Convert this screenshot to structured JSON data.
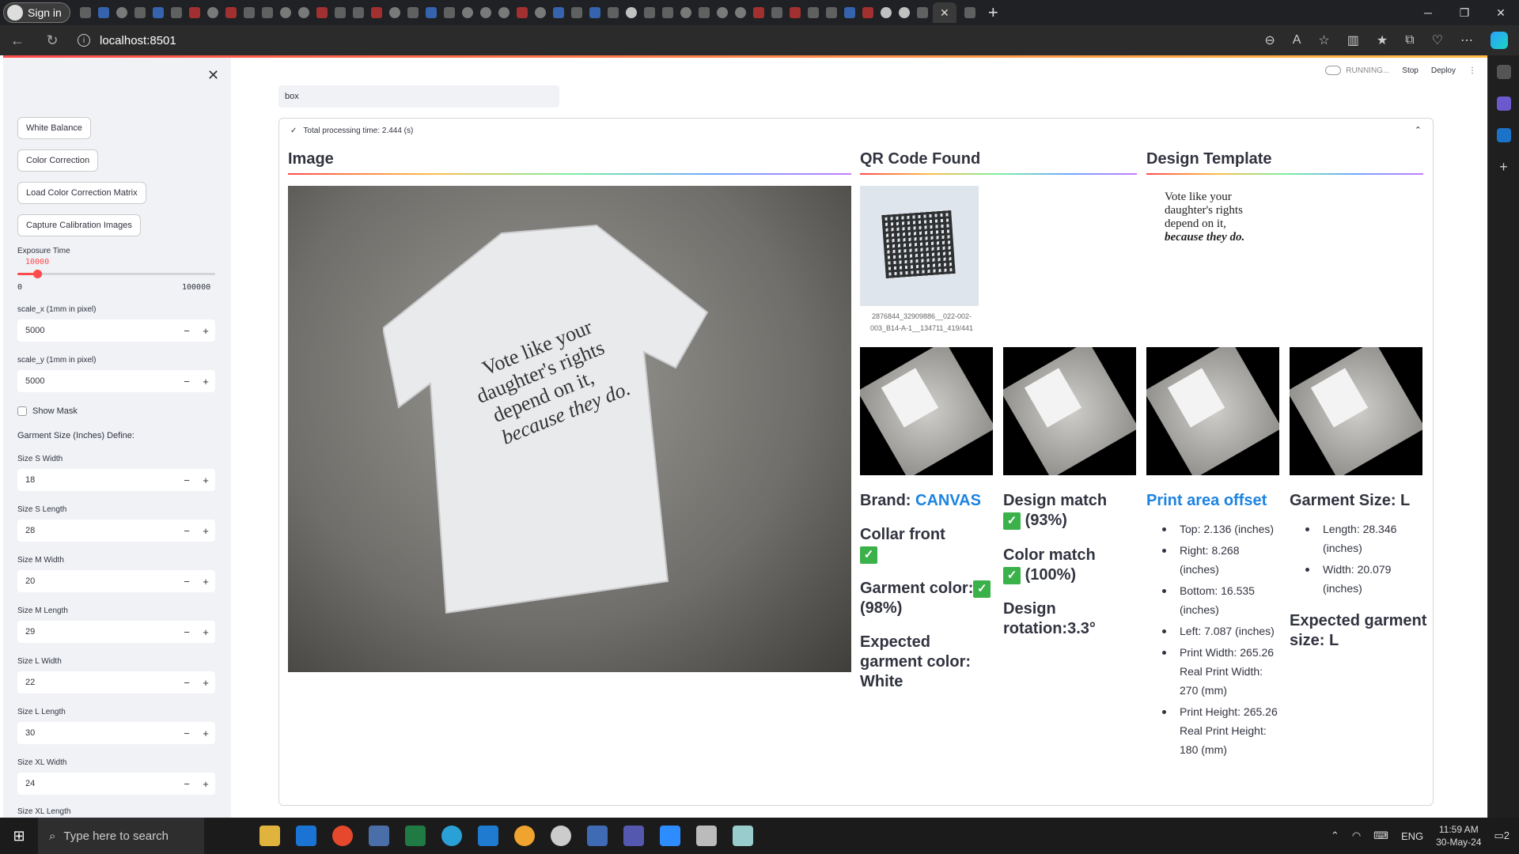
{
  "browser": {
    "signin_label": "Sign in",
    "url": "localhost:8501",
    "active_tab_close": "✕",
    "new_tab": "+"
  },
  "sidebar": {
    "buttons": [
      "White Balance",
      "Color Correction",
      "Load Color Correction Matrix",
      "Capture Calibration Images"
    ],
    "exposure": {
      "label": "Exposure Time",
      "value": "10000",
      "min": "0",
      "max": "100000",
      "fraction": 0.1
    },
    "scale_x": {
      "label": "scale_x (1mm in pixel)",
      "value": "5000"
    },
    "scale_y": {
      "label": "scale_y (1mm in pixel)",
      "value": "5000"
    },
    "show_mask": "Show Mask",
    "garment_define": "Garment Size (Inches) Define:",
    "sizes": [
      {
        "label": "Size S Width",
        "value": "18"
      },
      {
        "label": "Size S Length",
        "value": "28"
      },
      {
        "label": "Size M Width",
        "value": "20"
      },
      {
        "label": "Size M Length",
        "value": "29"
      },
      {
        "label": "Size L Width",
        "value": "22"
      },
      {
        "label": "Size L Length",
        "value": "30"
      },
      {
        "label": "Size XL Width",
        "value": "24"
      }
    ],
    "last_label": "Size XL Length"
  },
  "header": {
    "running": "RUNNING...",
    "stop": "Stop",
    "deploy": "Deploy"
  },
  "main": {
    "text_input": "box",
    "status": "Total processing time: 2.444 (s)",
    "col_image": "Image",
    "col_qr": "QR Code Found",
    "col_template": "Design Template",
    "qr_caption": "2876844_32909886__022-002-003_B14-A-1__134711_419/441",
    "template_lines": [
      "Vote like your",
      "daughter's rights",
      "depend on it,",
      "because they do."
    ],
    "shirt_text": [
      "Vote like your",
      "daughter's rights",
      "depend on it,",
      "because they do."
    ],
    "brand_label": "Brand: ",
    "brand_value": "CANVAS",
    "collar": "Collar front",
    "garment_color": "Garment color:",
    "garment_color_pct": "(98%)",
    "expected_color": "Expected garment color: White",
    "design_match": "Design match",
    "design_match_pct": "(93%)",
    "color_match": "Color match",
    "color_match_pct": "(100%)",
    "design_rotation": "Design rotation:3.3°",
    "print_offset_title": "Print area offset",
    "print_offset": [
      "Top: 2.136 (inches)",
      "Right: 8.268 (inches)",
      "Bottom: 16.535 (inches)",
      "Left: 7.087 (inches)",
      "Print Width: 265.26 Real Print Width: 270 (mm)",
      "Print Height: 265.26 Real Print Height: 180 (mm)"
    ],
    "garment_size_title": "Garment Size: L",
    "garment_size": [
      "Length: 28.346 (inches)",
      "Width: 20.079 (inches)"
    ],
    "expected_size": "Expected garment size: L"
  },
  "taskbar": {
    "search_placeholder": "Type here to search",
    "time": "11:59 AM",
    "date": "30-May-24",
    "lang": "ENG",
    "notif": "2"
  },
  "colors": {
    "accent": "#ff4b4b",
    "link": "#1c83e1",
    "check": "#3bb14a"
  }
}
